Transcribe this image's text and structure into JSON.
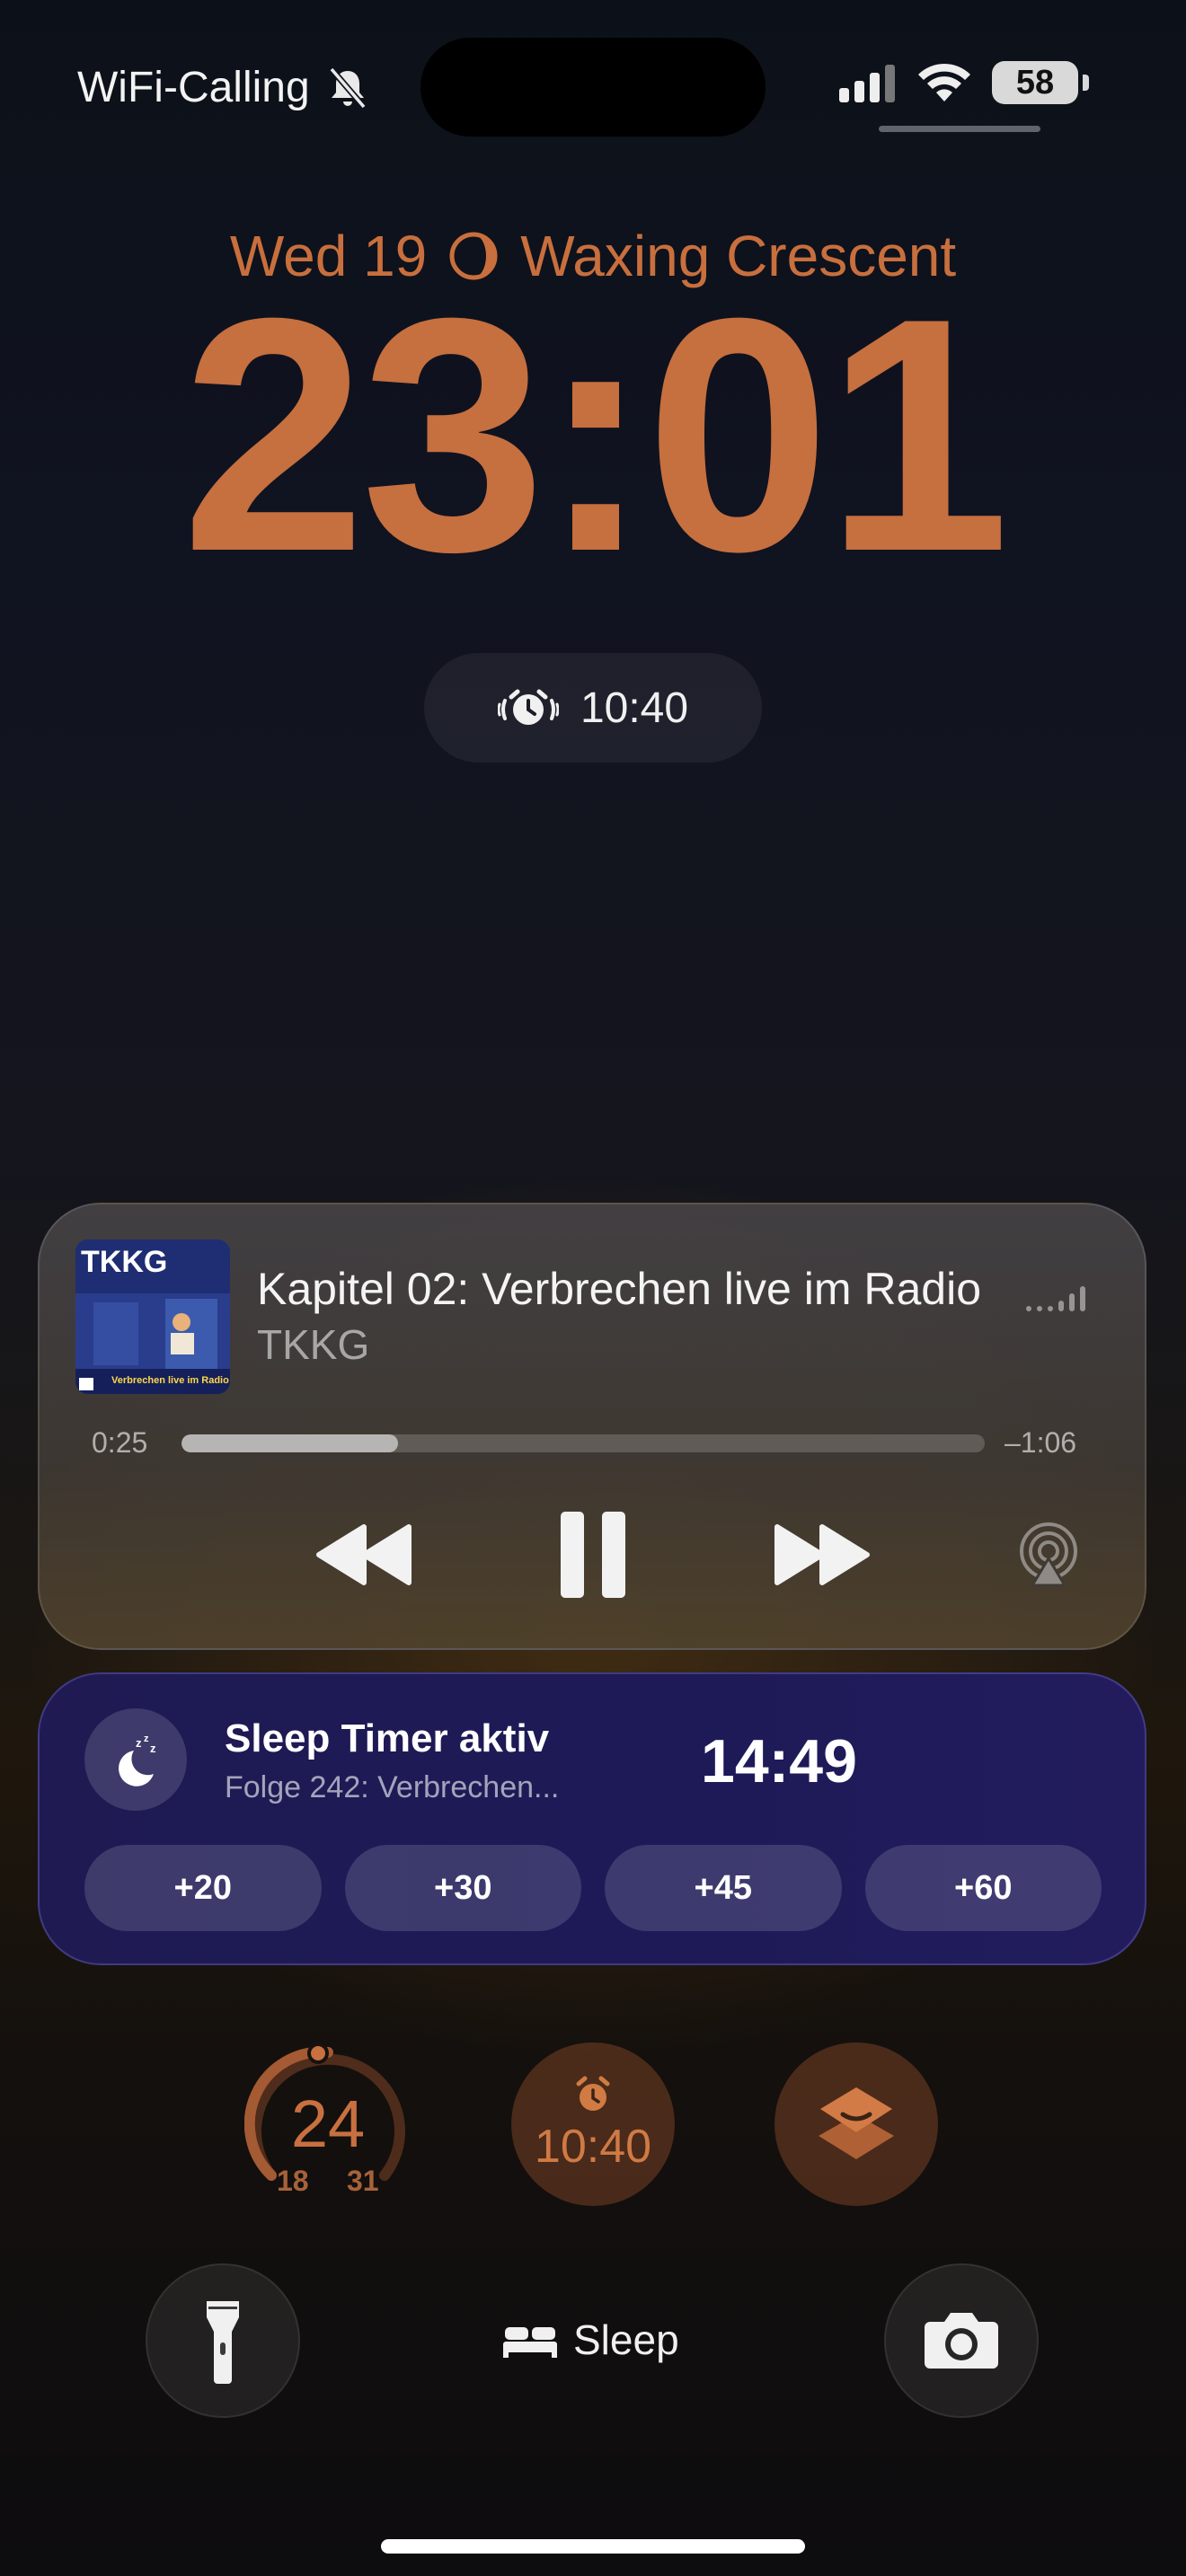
{
  "status_bar": {
    "carrier": "WiFi-Calling",
    "battery": "58"
  },
  "lock": {
    "date": "Wed 19",
    "moon_phase": "Waxing Crescent",
    "time": "23:01",
    "alarm_time": "10:40"
  },
  "now_playing": {
    "artwork_brand": "TKKG",
    "artwork_caption": "Verbrechen live im Radio",
    "title": "Kapitel 02: Verbrechen live im Radio",
    "artist": "TKKG",
    "elapsed": "0:25",
    "remaining": "–1:06",
    "progress": 0.27
  },
  "sleep_timer": {
    "title": "Sleep Timer aktiv",
    "subtitle": "Folge 242: Verbrechen...",
    "countdown": "14:49",
    "buttons": [
      "+20",
      "+30",
      "+45",
      "+60"
    ]
  },
  "widgets": {
    "weather_temp": "24",
    "weather_low": "18",
    "weather_high": "31",
    "alarm_time": "10:40"
  },
  "bottom": {
    "focus_label": "Sleep"
  },
  "colors": {
    "accent": "#c66f3f",
    "timer_card": "#1f1a52"
  }
}
